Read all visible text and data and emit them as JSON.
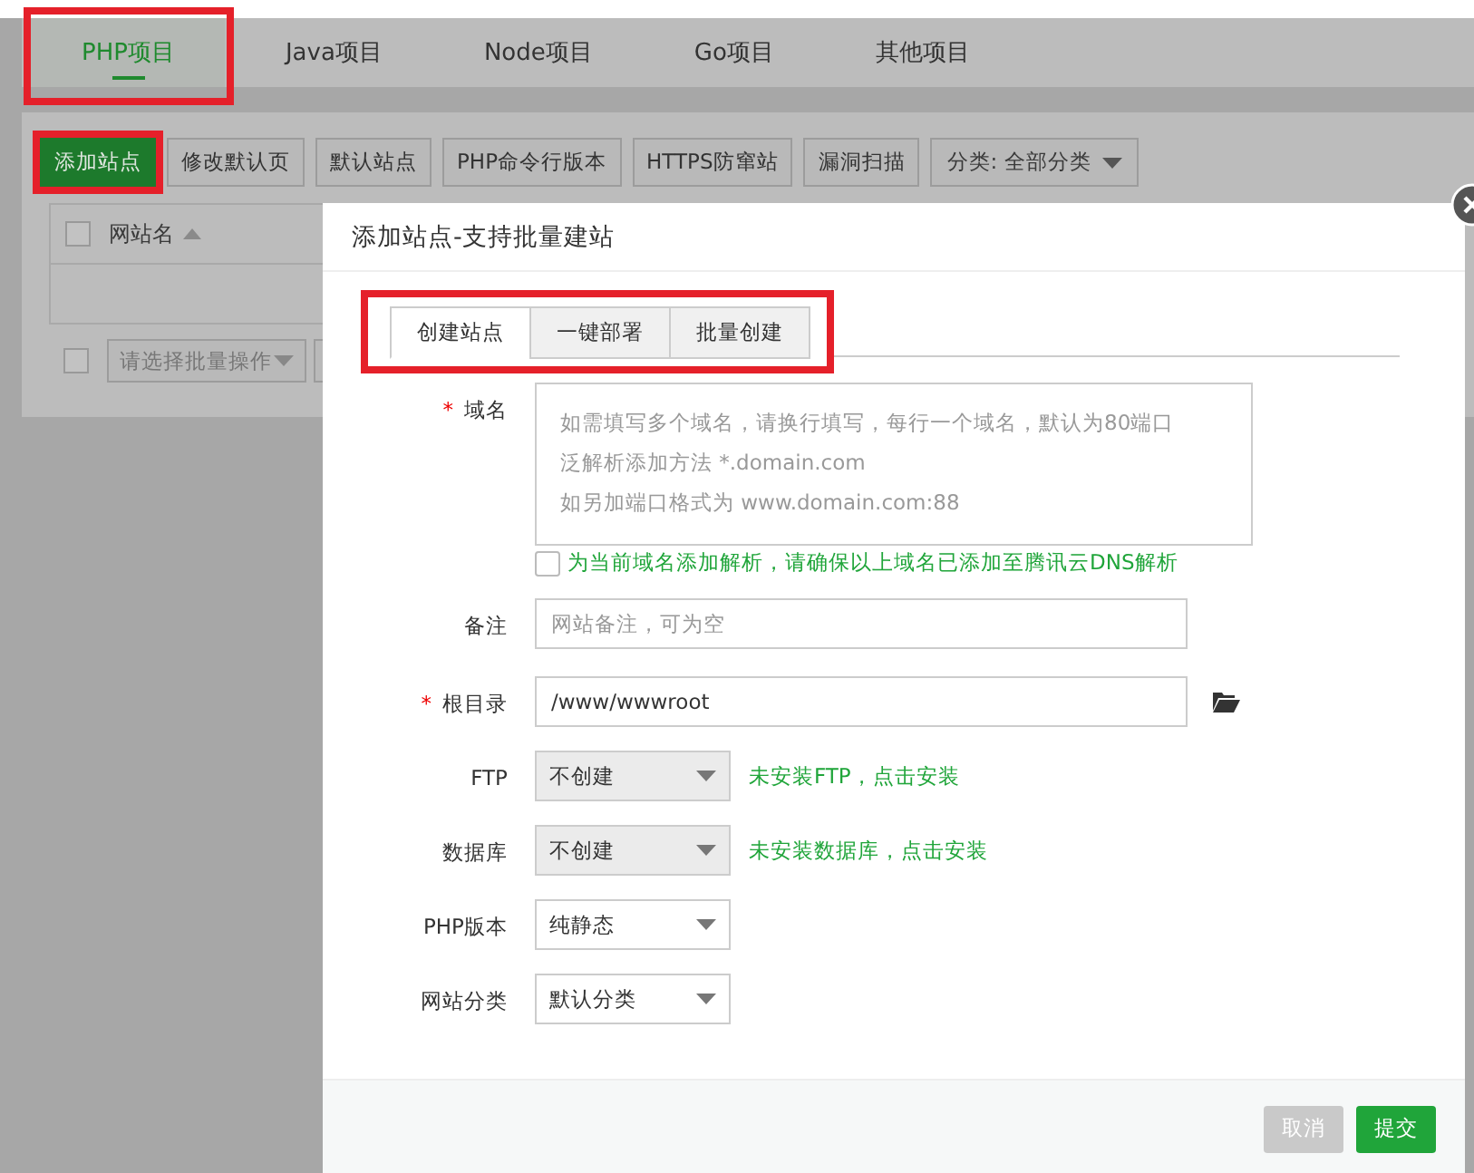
{
  "project_tabs": [
    {
      "label": "PHP项目",
      "selected": true,
      "highlighted": true
    },
    {
      "label": "Java项目",
      "selected": false,
      "highlighted": false
    },
    {
      "label": "Node项目",
      "selected": false,
      "highlighted": false
    },
    {
      "label": "Go项目",
      "selected": false,
      "highlighted": false
    },
    {
      "label": "其他项目",
      "selected": false,
      "highlighted": false
    }
  ],
  "toolbar": {
    "buttons": [
      {
        "label": "添加站点",
        "kind": "primary",
        "highlighted": true
      },
      {
        "label": "修改默认页",
        "kind": "default",
        "highlighted": false
      },
      {
        "label": "默认站点",
        "kind": "default",
        "highlighted": false
      },
      {
        "label": "PHP命令行版本",
        "kind": "default",
        "highlighted": false
      },
      {
        "label": "HTTPS防窜站",
        "kind": "default",
        "highlighted": false
      },
      {
        "label": "漏洞扫描",
        "kind": "default",
        "highlighted": false
      }
    ],
    "category_select": "分类: 全部分类"
  },
  "site_table": {
    "columns": [
      {
        "label": "网站名",
        "checked": false
      }
    ],
    "batch_select": "请选择批量操作",
    "batch_checked": false
  },
  "dialog": {
    "title": "添加站点-支持批量建站",
    "tabs_highlighted": true,
    "tabs": [
      {
        "label": "创建站点",
        "selected": true
      },
      {
        "label": "一键部署",
        "selected": false
      },
      {
        "label": "批量创建",
        "selected": false
      }
    ],
    "fields": [
      {
        "kind": "textarea",
        "label": "域名",
        "marker": "*",
        "placeholder_lines": [
          "如需填写多个域名，请换行填写，每行一个域名，默认为80端口",
          "泛解析添加方法 *.domain.com",
          "如另加端口格式为 www.domain.com:88"
        ]
      },
      {
        "kind": "checkbox",
        "checked": false,
        "label": "为当前域名添加解析，请确保以上域名已添加至腾讯云DNS解析"
      },
      {
        "kind": "input",
        "label": "备注",
        "placeholder": "网站备注，可为空"
      },
      {
        "kind": "path",
        "label": "根目录",
        "marker": "*",
        "value": "/www/wwwroot"
      },
      {
        "kind": "select",
        "label": "FTP",
        "value": "不创建",
        "hint": "未安装FTP，点击安装",
        "shaded": true
      },
      {
        "kind": "select",
        "label": "数据库",
        "value": "不创建",
        "hint": "未安装数据库，点击安装",
        "shaded": true
      },
      {
        "kind": "select",
        "label": "PHP版本",
        "value": "纯静态",
        "shaded": false
      },
      {
        "kind": "select",
        "label": "网站分类",
        "value": "默认分类",
        "shaded": false
      }
    ],
    "buttons": [
      {
        "label": "取消",
        "kind": "cancel"
      },
      {
        "label": "提交",
        "kind": "submit"
      }
    ]
  }
}
